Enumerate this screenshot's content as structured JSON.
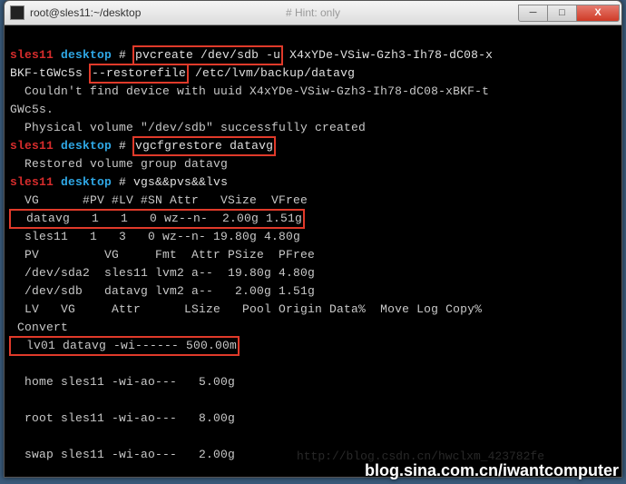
{
  "titlebar": {
    "title": "root@sles11:~/desktop",
    "mid_hint": "# Hint: only"
  },
  "win_buttons": {
    "min": "─",
    "max": "□",
    "close": "X"
  },
  "p1": {
    "host": "sles11",
    "path": " desktop",
    "cmd_boxed": "pvcreate /dev/sdb -u",
    "cmd_tail1": " X4xYDe-VSiw-Gzh3-Ih78-dC08-x",
    "line2a": "BKF-tGWc5s ",
    "line2_boxed": "--restorefile",
    "line2b": " /etc/lvm/backup/datavg"
  },
  "out1": {
    "l1": "  Couldn't find device with uuid X4xYDe-VSiw-Gzh3-Ih78-dC08-xBKF-t",
    "l2": "GWc5s.",
    "l3": "  Physical volume \"/dev/sdb\" successfully created"
  },
  "p2": {
    "host": "sles11",
    "path": " desktop",
    "cmd_boxed": "vgcfgrestore datavg"
  },
  "out2": {
    "l1": "  Restored volume group datavg"
  },
  "p3": {
    "host": "sles11",
    "path": " desktop",
    "cmd": " vgs&&pvs&&lvs"
  },
  "vgs": {
    "hdr": "  VG      #PV #LV #SN Attr   VSize  VFree",
    "row1": "  datavg   1   1   0 wz--n-  2.00g 1.51g",
    "row2": "  sles11   1   3   0 wz--n- 19.80g 4.80g"
  },
  "pvs": {
    "hdr": "  PV         VG     Fmt  Attr PSize  PFree",
    "row1": "  /dev/sda2  sles11 lvm2 a--  19.80g 4.80g",
    "row2": "  /dev/sdb   datavg lvm2 a--   2.00g 1.51g"
  },
  "lvs": {
    "hdr1": "  LV   VG     Attr      LSize   Pool Origin Data%  Move Log Copy%",
    "hdr2": " Convert",
    "row1": "  lv01 datavg -wi------ 500.00m",
    "gap": "",
    "row2": "  home sles11 -wi-ao---   5.00g",
    "row3": "  root sles11 -wi-ao---   8.00g",
    "row4": "  swap sles11 -wi-ao---   2.00g"
  },
  "faded_url": "http://blog.csdn.cn/hwclxm_423782fe",
  "watermark": "blog.sina.com.cn/iwantcomputer"
}
